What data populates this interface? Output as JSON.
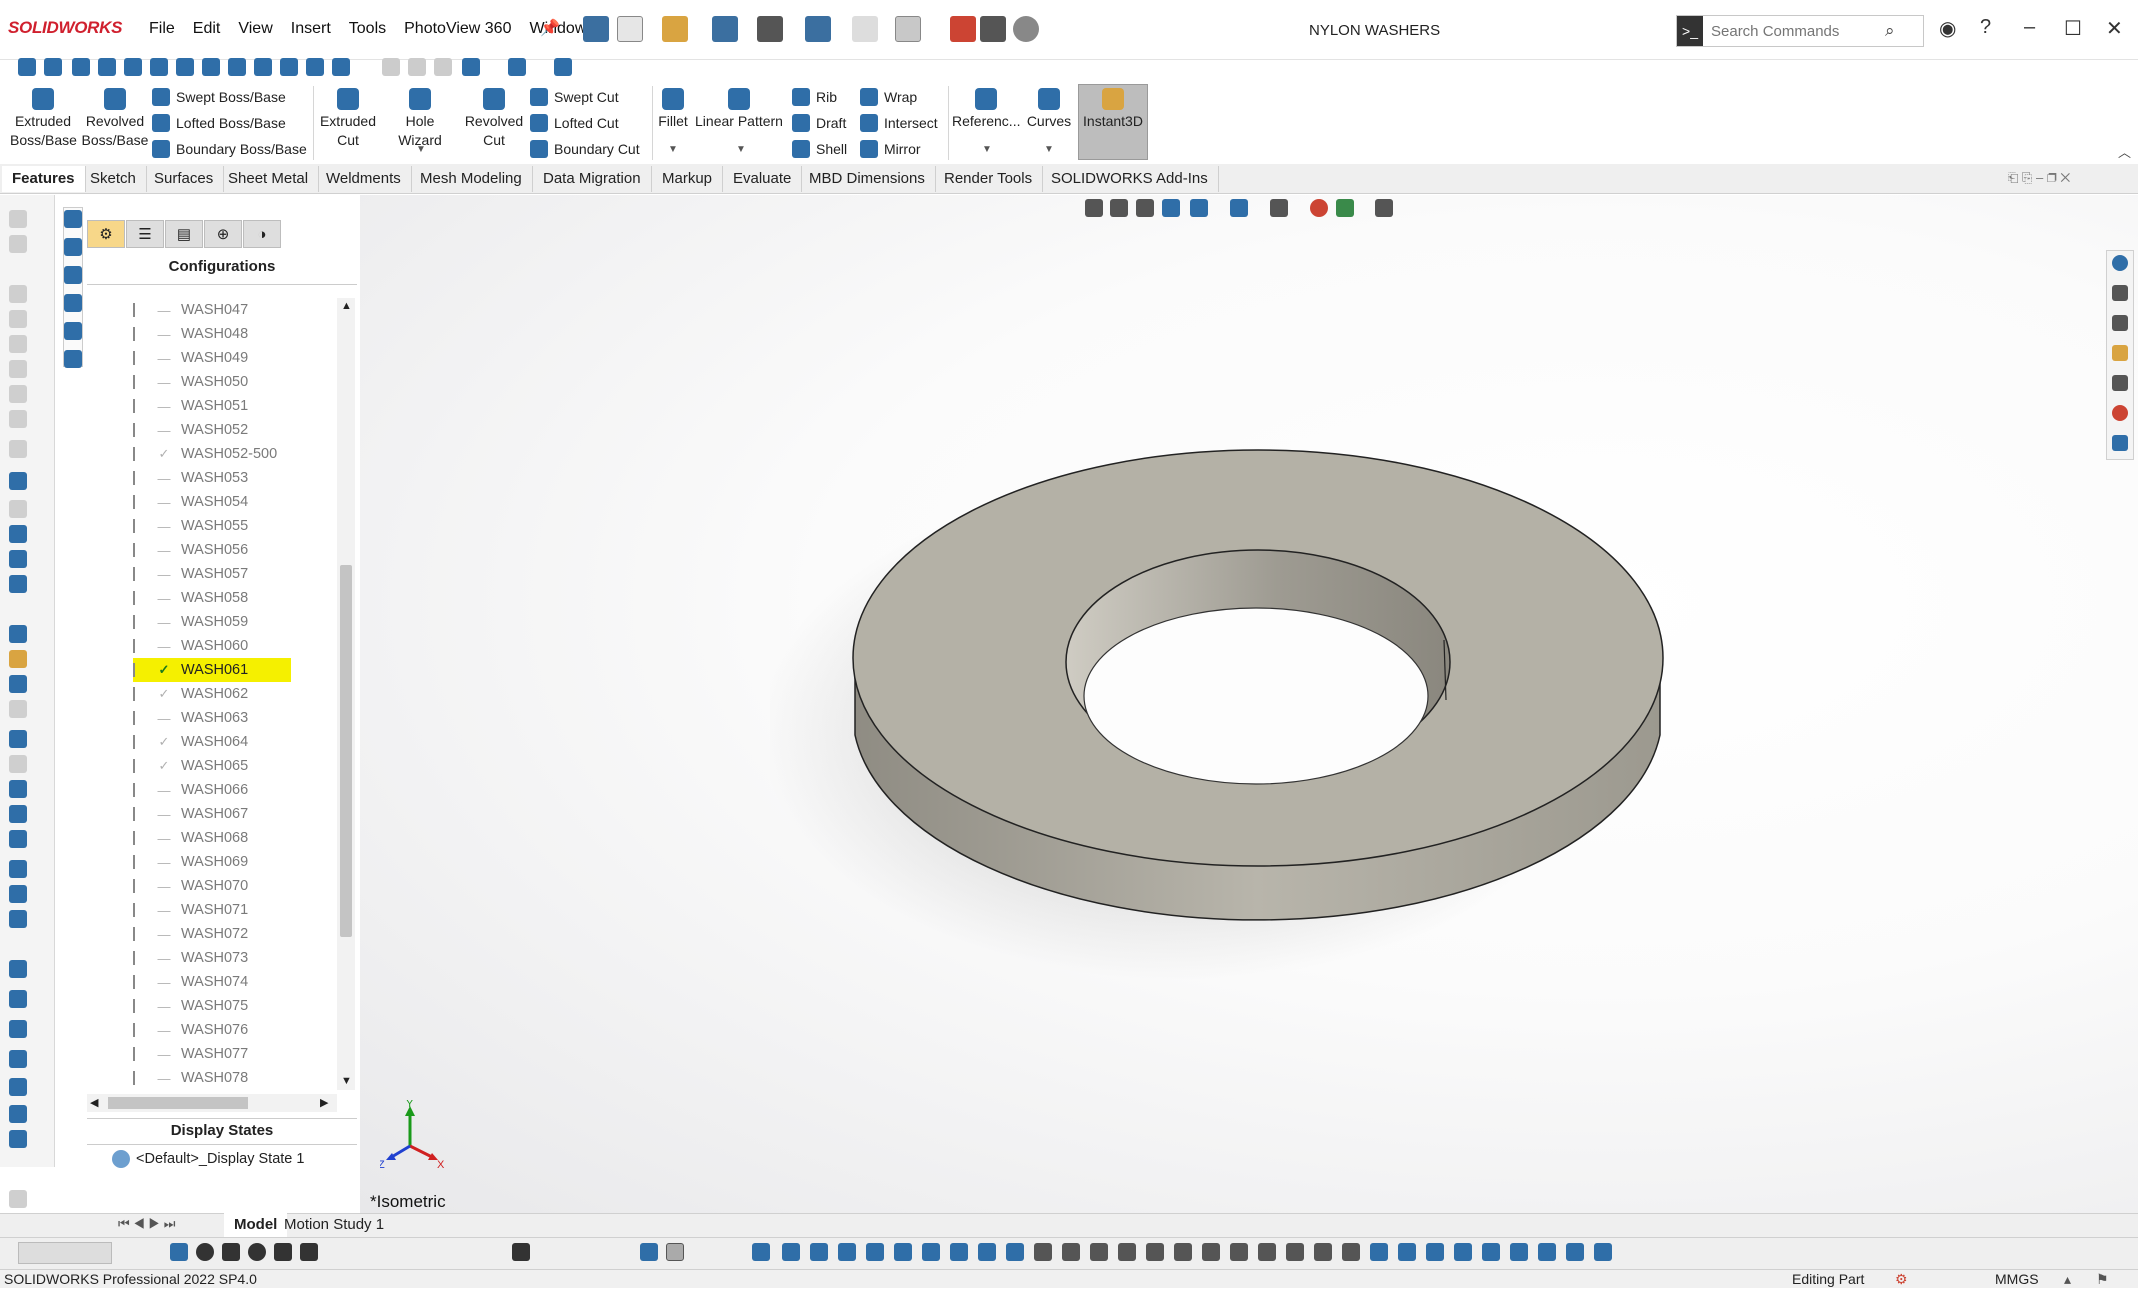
{
  "app": {
    "logo": "SOLIDWORKS",
    "doc_title": "NYLON WASHERS"
  },
  "menu": [
    "File",
    "Edit",
    "View",
    "Insert",
    "Tools",
    "PhotoView 360",
    "Window"
  ],
  "search": {
    "placeholder": "Search Commands"
  },
  "commands": {
    "extruded_boss": "Extruded\nBoss/Base",
    "revolved_boss": "Revolved\nBoss/Base",
    "swept_boss": "Swept Boss/Base",
    "lofted_boss": "Lofted Boss/Base",
    "boundary_boss": "Boundary Boss/Base",
    "extruded_cut": "Extruded\nCut",
    "hole_wizard": "Hole Wizard",
    "revolved_cut": "Revolved\nCut",
    "swept_cut": "Swept Cut",
    "lofted_cut": "Lofted Cut",
    "boundary_cut": "Boundary Cut",
    "fillet": "Fillet",
    "linear_pattern": "Linear Pattern",
    "rib": "Rib",
    "draft": "Draft",
    "shell": "Shell",
    "wrap": "Wrap",
    "intersect": "Intersect",
    "mirror": "Mirror",
    "reference": "Referenc...",
    "curves": "Curves",
    "instant3d": "Instant3D"
  },
  "tabs": [
    "Features",
    "Sketch",
    "Surfaces",
    "Sheet Metal",
    "Weldments",
    "Mesh Modeling",
    "Data Migration",
    "Markup",
    "Evaluate",
    "MBD Dimensions",
    "Render Tools",
    "SOLIDWORKS Add-Ins"
  ],
  "panel": {
    "configurations_title": "Configurations",
    "display_states_title": "Display States",
    "display_state_item": "<Default>_Display State 1",
    "configs": [
      {
        "name": "WASH047",
        "mark": "—"
      },
      {
        "name": "WASH048",
        "mark": "—"
      },
      {
        "name": "WASH049",
        "mark": "—"
      },
      {
        "name": "WASH050",
        "mark": "—"
      },
      {
        "name": "WASH051",
        "mark": "—"
      },
      {
        "name": "WASH052",
        "mark": "—"
      },
      {
        "name": "WASH052-500",
        "mark": "✓"
      },
      {
        "name": "WASH053",
        "mark": "—"
      },
      {
        "name": "WASH054",
        "mark": "—"
      },
      {
        "name": "WASH055",
        "mark": "—"
      },
      {
        "name": "WASH056",
        "mark": "—"
      },
      {
        "name": "WASH057",
        "mark": "—"
      },
      {
        "name": "WASH058",
        "mark": "—"
      },
      {
        "name": "WASH059",
        "mark": "—"
      },
      {
        "name": "WASH060",
        "mark": "—"
      },
      {
        "name": "WASH061",
        "mark": "✓",
        "active": true
      },
      {
        "name": "WASH062",
        "mark": "✓"
      },
      {
        "name": "WASH063",
        "mark": "—"
      },
      {
        "name": "WASH064",
        "mark": "✓"
      },
      {
        "name": "WASH065",
        "mark": "✓"
      },
      {
        "name": "WASH066",
        "mark": "—"
      },
      {
        "name": "WASH067",
        "mark": "—"
      },
      {
        "name": "WASH068",
        "mark": "—"
      },
      {
        "name": "WASH069",
        "mark": "—"
      },
      {
        "name": "WASH070",
        "mark": "—"
      },
      {
        "name": "WASH071",
        "mark": "—"
      },
      {
        "name": "WASH072",
        "mark": "—"
      },
      {
        "name": "WASH073",
        "mark": "—"
      },
      {
        "name": "WASH074",
        "mark": "—"
      },
      {
        "name": "WASH075",
        "mark": "—"
      },
      {
        "name": "WASH076",
        "mark": "—"
      },
      {
        "name": "WASH077",
        "mark": "—"
      },
      {
        "name": "WASH078",
        "mark": "—"
      }
    ]
  },
  "viewport": {
    "view_label": "*Isometric",
    "axis_x": "X",
    "axis_y": "Y",
    "axis_z": "Z"
  },
  "bottom_tabs": [
    "Model",
    "Motion Study 1"
  ],
  "status": {
    "left": "SOLIDWORKS Professional 2022 SP4.0",
    "mode": "Editing Part",
    "units": "MMGS"
  },
  "colors": {
    "accent": "#2f6ea8",
    "highlight": "#f5f000",
    "washer_top": "#b4b1a6",
    "washer_side": "#a09d93"
  }
}
